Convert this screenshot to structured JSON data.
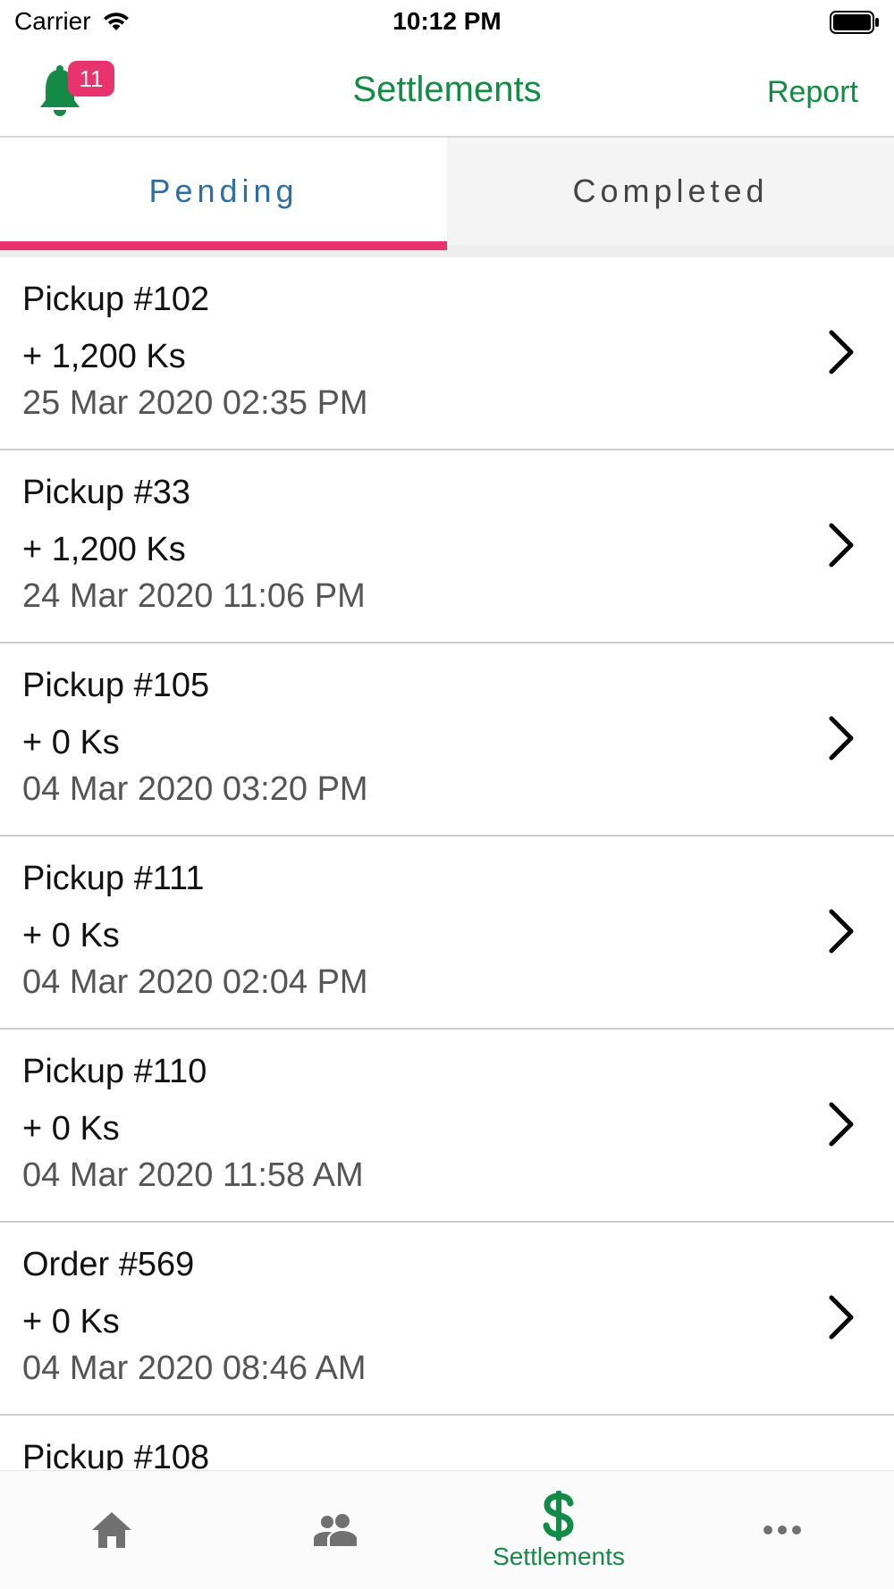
{
  "status_bar": {
    "carrier": "Carrier",
    "time": "10:12 PM"
  },
  "header": {
    "title": "Settlements",
    "report_label": "Report",
    "notification_count": "11"
  },
  "tabs": [
    {
      "label": "Pending",
      "selected": true
    },
    {
      "label": "Completed",
      "selected": false
    }
  ],
  "settlements": [
    {
      "title": "Pickup #102",
      "amount": "+ 1,200 Ks",
      "date": "25 Mar 2020 02:35 PM"
    },
    {
      "title": "Pickup #33",
      "amount": "+ 1,200 Ks",
      "date": "24 Mar 2020 11:06 PM"
    },
    {
      "title": "Pickup #105",
      "amount": "+ 0 Ks",
      "date": "04 Mar 2020 03:20 PM"
    },
    {
      "title": "Pickup #111",
      "amount": "+ 0 Ks",
      "date": "04 Mar 2020 02:04 PM"
    },
    {
      "title": "Pickup #110",
      "amount": "+ 0 Ks",
      "date": "04 Mar 2020 11:58 AM"
    },
    {
      "title": "Order #569",
      "amount": "+ 0 Ks",
      "date": "04 Mar 2020 08:46 AM"
    },
    {
      "title": "Pickup #108",
      "amount": "",
      "date": ""
    }
  ],
  "tab_bar": {
    "items": [
      {
        "icon": "home-icon",
        "label": ""
      },
      {
        "icon": "people-icon",
        "label": ""
      },
      {
        "icon": "dollar-icon",
        "label": "Settlements"
      },
      {
        "icon": "more-icon",
        "label": ""
      }
    ],
    "active_index": 2
  },
  "colors": {
    "accent_green": "#138a46",
    "badge_pink": "#e8336e",
    "tab_blue": "#2e6fa3",
    "inactive_icon": "#707070"
  }
}
